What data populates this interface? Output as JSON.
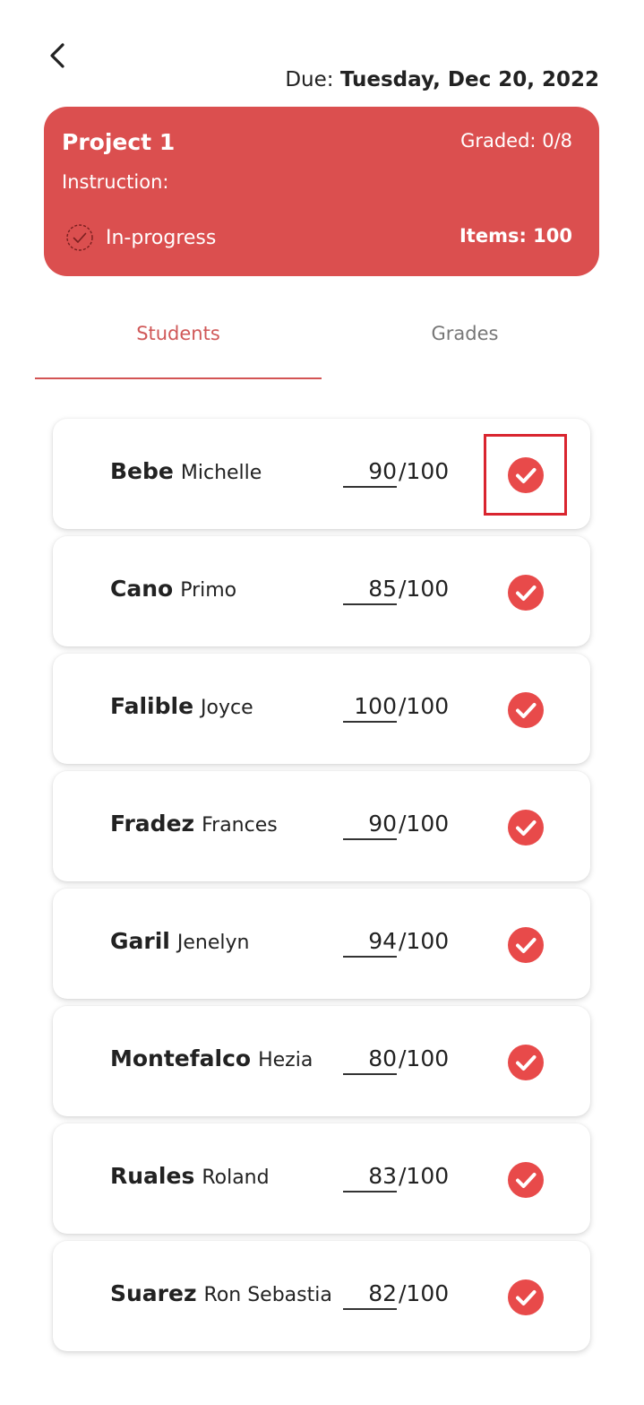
{
  "header": {
    "due_label": "Due:",
    "due_date": "Tuesday, Dec 20, 2022"
  },
  "project": {
    "title": "Project 1",
    "graded_label": "Graded:",
    "graded_value": "0/8",
    "instruction_label": "Instruction:",
    "status": "In-progress",
    "items_label": "Items:",
    "items_value": "100",
    "card_color": "#db4f4f"
  },
  "tabs": [
    {
      "label": "Students",
      "active": true
    },
    {
      "label": "Grades",
      "active": false
    }
  ],
  "students": [
    {
      "last": "Bebe",
      "first": "Michelle",
      "score": "90",
      "max": "/100"
    },
    {
      "last": "Cano",
      "first": "Primo",
      "score": "85",
      "max": "/100"
    },
    {
      "last": "Falible",
      "first": "Joyce",
      "score": "100",
      "max": "/100"
    },
    {
      "last": "Fradez",
      "first": "Frances",
      "score": "90",
      "max": "/100"
    },
    {
      "last": "Garil",
      "first": "Jenelyn",
      "score": "94",
      "max": "/100"
    },
    {
      "last": "Montefalco",
      "first": "Hezia",
      "score": "80",
      "max": "/100"
    },
    {
      "last": "Ruales",
      "first": "Roland",
      "score": "83",
      "max": "/100"
    },
    {
      "last": "Suarez",
      "first": "Ron Sebastia",
      "score": "82",
      "max": "/100"
    }
  ],
  "icons": {
    "back": "chevron-left-icon",
    "status": "check-circle-outline-icon",
    "row_action": "check-circle-icon"
  },
  "colors": {
    "accent": "#d65454",
    "check": "#e84a4a"
  }
}
